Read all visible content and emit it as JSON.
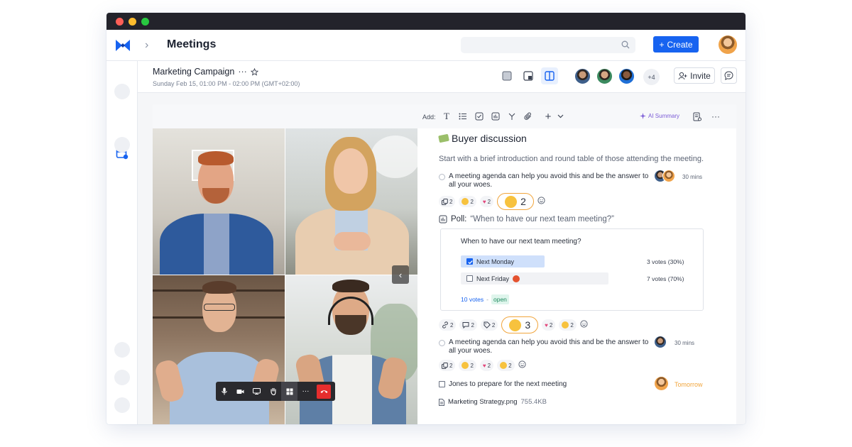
{
  "header": {
    "app_title": "Meetings",
    "create_label": "Create"
  },
  "meeting": {
    "title": "Marketing Campaign",
    "subtitle": "Sunday Feb 15, 01:00 PM - 02:00 PM (GMT+02:00)",
    "participants_more": "+4",
    "invite_label": "Invite"
  },
  "toolbar": {
    "add_label": "Add:",
    "ai_summary_label": "AI Summary"
  },
  "notes": {
    "heading": "Buyer discussion",
    "intro": "Start with a brief introduction and round table of those attending the meeting.",
    "agenda1": {
      "text": "A meeting agenda can help you avoid this and be the answer to all your woes.",
      "duration": "30 mins"
    },
    "reactions1": {
      "copy_count": "2",
      "hug_count": "2",
      "heart_count": "2",
      "featured_count": "2"
    },
    "poll": {
      "label": "Poll:",
      "question_quoted": "“When to have our next team meeting?”",
      "question": "When to have our next team meeting?",
      "options": [
        {
          "label": "Next Monday",
          "result": "3 votes (30%)",
          "checked": true
        },
        {
          "label": "Next Friday",
          "result": "7 votes (70%)",
          "checked": false
        }
      ],
      "total_votes": "10 votes",
      "separator": "-",
      "status": "open"
    },
    "reactions2": {
      "link_count": "2",
      "comment_count": "2",
      "tag_count": "2",
      "featured_count": "3",
      "heart_count": "2",
      "thumb_count": "2"
    },
    "agenda2": {
      "text": "A meeting agenda can help you avoid this and be the answer to all your woes.",
      "duration": "30 mins"
    },
    "reactions3": {
      "copy_count": "2",
      "hug_count": "2",
      "heart_count": "2",
      "thumb_count": "2"
    },
    "task": {
      "text": "Jones to prepare for the next meeting",
      "due": "Tomorrow"
    },
    "file": {
      "name": "Marketing Strategy.png",
      "size": "755.4KB"
    }
  },
  "colors": {
    "accent": "#1763f0",
    "highlight": "#f1a53c",
    "end_call": "#e62d2d"
  }
}
